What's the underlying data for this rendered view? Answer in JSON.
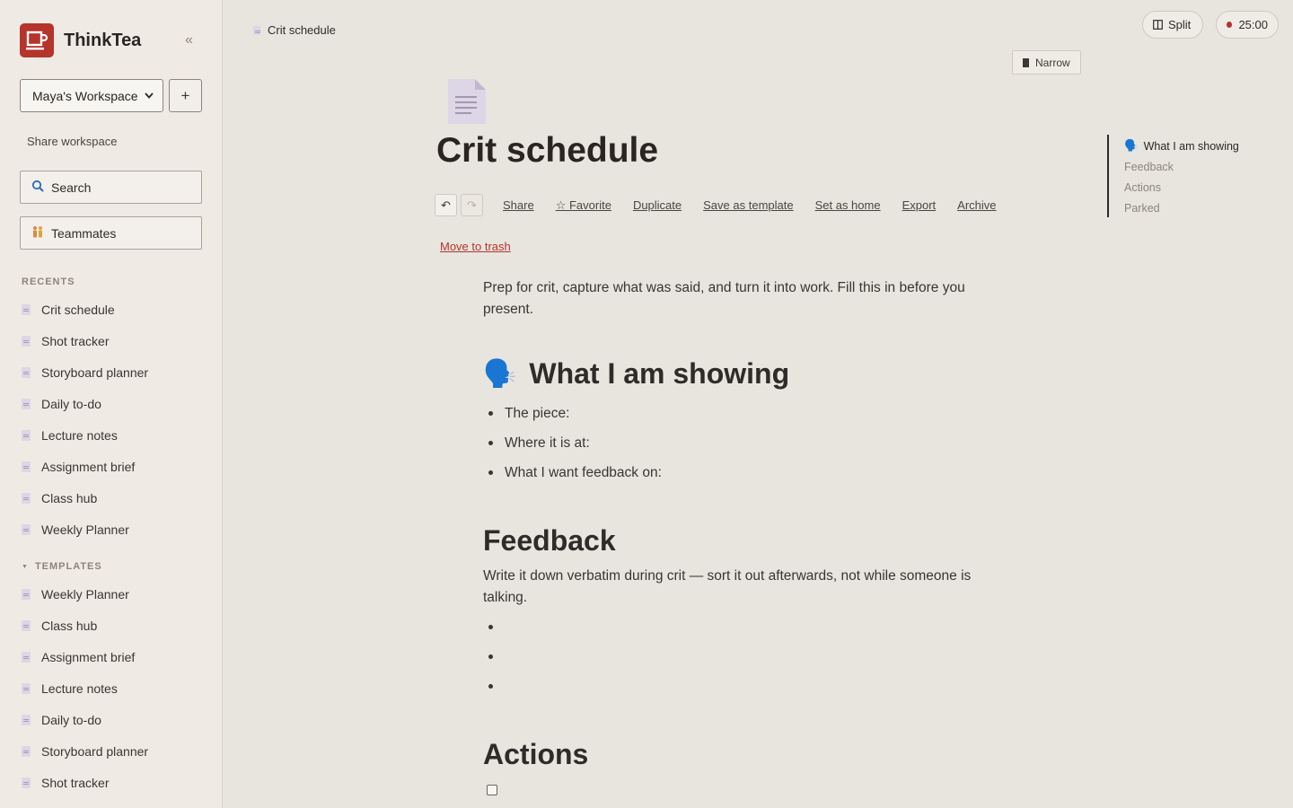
{
  "app": {
    "name": "ThinkTea",
    "collapse_icon": "«"
  },
  "workspace": {
    "name": "Maya's Workspace",
    "add_label": "+",
    "share_label": "Share workspace"
  },
  "sidebar": {
    "search_label": "Search",
    "teammates_label": "Teammates",
    "recents_title": "RECENTS",
    "recents": [
      "Crit schedule",
      "Shot tracker",
      "Storyboard planner",
      "Daily to-do",
      "Lecture notes",
      "Assignment brief",
      "Class hub",
      "Weekly Planner"
    ],
    "templates_title": "TEMPLATES",
    "templates": [
      "Weekly Planner",
      "Class hub",
      "Assignment brief",
      "Lecture notes",
      "Daily to-do",
      "Storyboard planner",
      "Shot tracker"
    ]
  },
  "topbar": {
    "breadcrumb": "Crit schedule",
    "split_label": "Split",
    "timer_label": "25:00",
    "narrow_label": "Narrow"
  },
  "document": {
    "title": "Crit schedule",
    "actions": [
      "Share",
      "☆ Favorite",
      "Duplicate",
      "Save as template",
      "Set as home",
      "Export",
      "Archive"
    ],
    "undo": "↶",
    "redo": "↷",
    "trash_label": "Move to trash",
    "intro": "Prep for crit, capture what was said, and turn it into work. Fill this in before you present.",
    "section1": {
      "emoji": "🗣️",
      "heading": "What I am showing",
      "bullets": [
        "The piece:",
        "Where it is at:",
        "What I want feedback on:"
      ]
    },
    "section2": {
      "heading": "Feedback",
      "text": "Write it down verbatim during crit — sort it out afterwards, not while someone is talking.",
      "bullets": [
        "",
        "",
        ""
      ]
    },
    "section3": {
      "heading": "Actions"
    }
  },
  "toc": {
    "items": [
      {
        "emoji": "🗣️",
        "label": "What I am showing"
      },
      {
        "label": "Feedback"
      },
      {
        "label": "Actions"
      },
      {
        "label": "Parked"
      }
    ]
  },
  "colors": {
    "accent": "#b5342b",
    "background": "#e8e5df",
    "sidebar": "#efebe4"
  }
}
